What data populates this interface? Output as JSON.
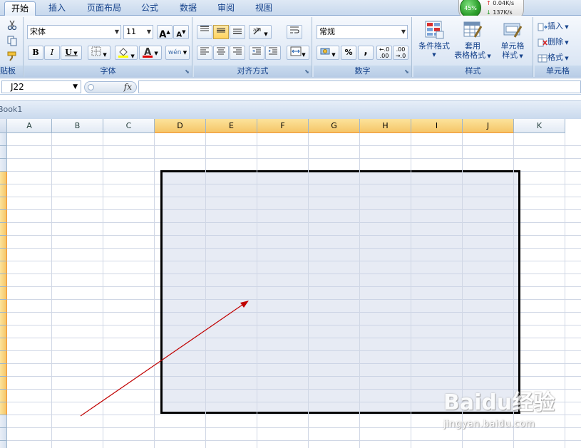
{
  "tabs": [
    {
      "label": "开始",
      "active": true
    },
    {
      "label": "插入"
    },
    {
      "label": "页面布局"
    },
    {
      "label": "公式"
    },
    {
      "label": "数据"
    },
    {
      "label": "审阅"
    },
    {
      "label": "视图"
    }
  ],
  "net_gadget": {
    "percent": "45%",
    "upload": "0.04K/s",
    "download": "137K/s"
  },
  "ribbon": {
    "clipboard": {
      "label": "贴板"
    },
    "font": {
      "label": "字体",
      "font_name": "宋体",
      "font_size": "11",
      "grow": "A",
      "shrink": "A",
      "bold": "B",
      "italic": "I",
      "underline": "U",
      "phonetic": "wén"
    },
    "alignment": {
      "label": "对齐方式"
    },
    "number": {
      "label": "数字",
      "format": "常规",
      "percent": "%",
      "comma": ","
    },
    "styles": {
      "label": "样式",
      "conditional": "条件格式",
      "table_format_1": "套用",
      "table_format_2": "表格格式",
      "cell_style_1": "单元格",
      "cell_style_2": "样式"
    },
    "cells": {
      "label": "单元格",
      "insert": "插入",
      "delete": "删除",
      "format": "格式"
    }
  },
  "formula_bar": {
    "name_box": "J22",
    "fx": "fx",
    "formula": ""
  },
  "workbook": {
    "title": "Book1"
  },
  "columns": [
    "A",
    "B",
    "C",
    "D",
    "E",
    "F",
    "G",
    "H",
    "I",
    "J",
    "K"
  ],
  "selected_columns": [
    "D",
    "E",
    "F",
    "G",
    "H",
    "I",
    "J"
  ],
  "selection_range": "D4:J22",
  "watermark": {
    "logo": "Baidu经验",
    "url": "jingyan.baidu.com"
  },
  "colors": {
    "ribbon_text": "#15428b",
    "selected_header": "#f5c567",
    "selection_fill": "#c6cfe5",
    "arrow": "#c00000"
  }
}
